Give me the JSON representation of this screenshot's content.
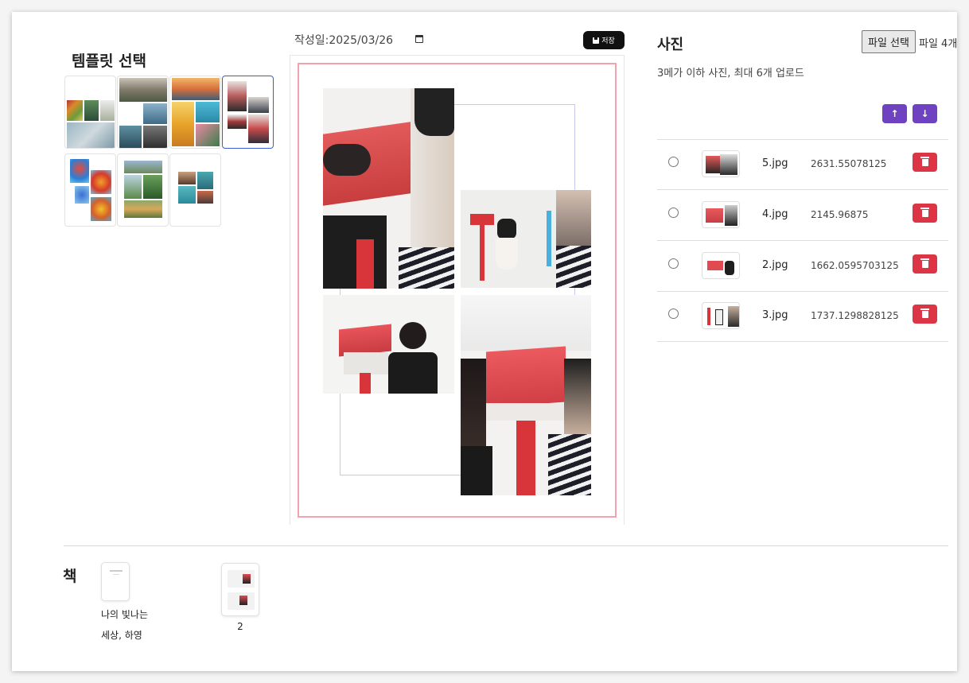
{
  "template_panel": {
    "title": "템플릿 선택"
  },
  "editor": {
    "date": "작성일:2025/03/26",
    "save_label": "저장"
  },
  "photos_panel": {
    "title": "사진",
    "file_button": "파일 선택",
    "file_count": "파일 4개",
    "hint": "3메가 이하 사진, 최대 6개 업로드",
    "up_icon": "arrow-up-icon",
    "down_icon": "arrow-down-icon",
    "rows": [
      {
        "name": "5.jpg",
        "size": "2631.55078125"
      },
      {
        "name": "4.jpg",
        "size": "2145.96875"
      },
      {
        "name": "2.jpg",
        "size": "1662.0595703125"
      },
      {
        "name": "3.jpg",
        "size": "1737.1298828125"
      }
    ]
  },
  "book": {
    "title": "책",
    "cover_name_line1": "나의 빛나는",
    "cover_name_line2": "세상, 하영",
    "page_number": "2"
  },
  "colors": {
    "accent_purple": "#6f42c1",
    "danger": "#dc3545",
    "page_border": "#f3a2ae",
    "frame_border": "#c8c8ee",
    "selected_template": "#3b5bd6"
  }
}
